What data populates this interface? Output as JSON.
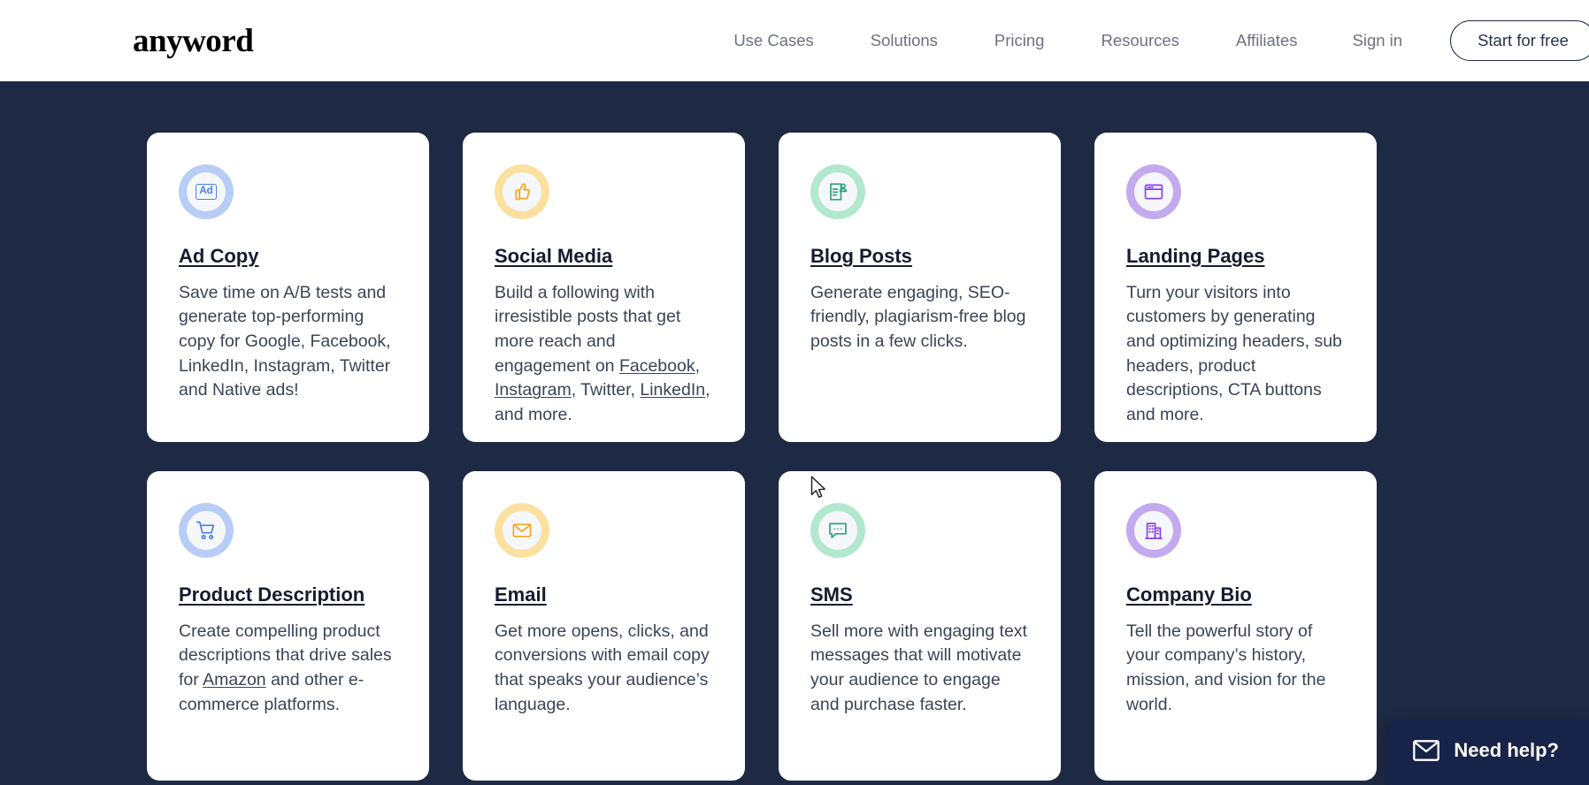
{
  "header": {
    "logo": "anyword",
    "nav": [
      {
        "label": "Use Cases",
        "name": "nav-use-cases"
      },
      {
        "label": "Solutions",
        "name": "nav-solutions"
      },
      {
        "label": "Pricing",
        "name": "nav-pricing"
      },
      {
        "label": "Resources",
        "name": "nav-resources"
      },
      {
        "label": "Affiliates",
        "name": "nav-affiliates"
      },
      {
        "label": "Sign in",
        "name": "nav-sign-in"
      }
    ],
    "cta_label": "Start for free"
  },
  "colors": {
    "page_background": "#1e2943",
    "card_background": "#ffffff",
    "header_background": "#ffffff",
    "nav_text": "#6e7180",
    "title_text": "#151c2e",
    "body_text": "#3b4456",
    "blue_ring": "#b8cdf5",
    "blue_icon": "#4a7ef0",
    "yellow_ring": "#fbe0a0",
    "orange_icon": "#f5a623",
    "green_ring": "#b2e8cd",
    "green_icon": "#2fa37a",
    "purple_ring": "#c3aaee",
    "purple_icon": "#8a3ff0",
    "widget_background": "#172349"
  },
  "cards": [
    {
      "title": "Ad Copy",
      "icon": "ad-badge-icon",
      "accent": "blue",
      "description_parts": [
        {
          "text": "Save time on A/B tests and generate top-performing copy for Google, Facebook, LinkedIn, Instagram, Twitter and Native ads!",
          "link": false
        }
      ]
    },
    {
      "title": "Social Media",
      "icon": "thumbs-up-icon",
      "accent": "yellow",
      "description_parts": [
        {
          "text": "Build a following with irresistible posts that get more reach and engagement on ",
          "link": false
        },
        {
          "text": "Facebook",
          "link": true
        },
        {
          "text": ", ",
          "link": false
        },
        {
          "text": "Instagram",
          "link": true
        },
        {
          "text": ", Twitter, ",
          "link": false
        },
        {
          "text": "LinkedIn",
          "link": true
        },
        {
          "text": ", and more.",
          "link": false
        }
      ]
    },
    {
      "title": "Blog Posts",
      "icon": "document-person-icon",
      "accent": "green",
      "description_parts": [
        {
          "text": "Generate engaging, SEO-friendly, plagiarism-free blog posts in a few clicks.",
          "link": false
        }
      ]
    },
    {
      "title": "Landing Pages",
      "icon": "browser-window-icon",
      "accent": "purple",
      "description_parts": [
        {
          "text": "Turn your visitors into customers by generating and optimizing headers, sub headers, product descriptions, CTA buttons and more.",
          "link": false
        }
      ]
    },
    {
      "title": "Product Description",
      "icon": "shopping-cart-icon",
      "accent": "blue",
      "description_parts": [
        {
          "text": "Create compelling product descriptions that drive sales for ",
          "link": false
        },
        {
          "text": "Amazon",
          "link": true
        },
        {
          "text": " and other e-commerce platforms.",
          "link": false
        }
      ]
    },
    {
      "title": "Email",
      "icon": "envelope-icon",
      "accent": "yellow",
      "description_parts": [
        {
          "text": "Get more opens, clicks, and conversions with email copy that speaks your audience’s language.",
          "link": false
        }
      ]
    },
    {
      "title": "SMS",
      "icon": "chat-bubble-icon",
      "accent": "green",
      "description_parts": [
        {
          "text": "Sell more with engaging text messages that will motivate your audience to engage and purchase faster.",
          "link": false
        }
      ]
    },
    {
      "title": "Company Bio",
      "icon": "building-icon",
      "accent": "purple",
      "description_parts": [
        {
          "text": "Tell the powerful story of your company’s history, mission, and vision for the world.",
          "link": false
        }
      ]
    }
  ],
  "widget": {
    "label": "Need help?",
    "icon": "envelope-icon"
  }
}
